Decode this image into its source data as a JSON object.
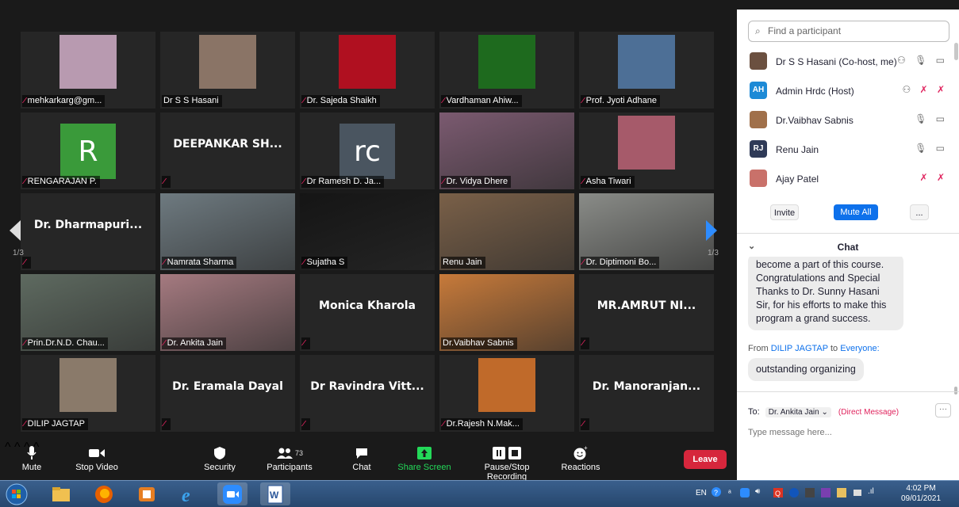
{
  "gallery": {
    "page_indicator_left": "1/3",
    "page_indicator_right": "1/3",
    "tiles": [
      {
        "name": "mehkarkarg@gm...",
        "muted": true,
        "kind": "photo",
        "photo_bg": "#b89ab0"
      },
      {
        "name": "Dr S S Hasani",
        "muted": false,
        "kind": "photo",
        "photo_bg": "#8a7466"
      },
      {
        "name": "Dr. Sajeda Shaikh",
        "muted": true,
        "kind": "photo",
        "photo_bg": "#b01020"
      },
      {
        "name": "Vardhaman Ahiw...",
        "muted": true,
        "kind": "photo",
        "photo_bg": "#1e6a1e"
      },
      {
        "name": "Prof. Jyoti Adhane",
        "muted": true,
        "kind": "photo",
        "photo_bg": "#4d6f96"
      },
      {
        "name": "RENGARAJAN P.",
        "muted": true,
        "kind": "letter",
        "letter": "R",
        "letter_bg": "#3a9a3a"
      },
      {
        "name": "",
        "muted": true,
        "kind": "text",
        "big": "DEEPANKAR SH..."
      },
      {
        "name": "Dr Ramesh D. Ja...",
        "muted": true,
        "kind": "letter",
        "letter": "rc",
        "letter_bg": "#4a5560"
      },
      {
        "name": "Dr. Vidya Dhere",
        "muted": true,
        "kind": "video",
        "photo_bg": "#7b5a70"
      },
      {
        "name": "Asha Tiwari",
        "muted": true,
        "kind": "photo",
        "photo_bg": "#a65a6a"
      },
      {
        "name": "",
        "muted": true,
        "kind": "text",
        "big": "Dr. Dharmapuri..."
      },
      {
        "name": "Namrata Sharma",
        "muted": true,
        "kind": "video",
        "photo_bg": "#6e7a80"
      },
      {
        "name": "Sujatha S",
        "muted": true,
        "kind": "video",
        "photo_bg": "#151515"
      },
      {
        "name": "Renu Jain",
        "muted": false,
        "kind": "video",
        "photo_bg": "#7a6048"
      },
      {
        "name": "Dr. Diptimoni Bo...",
        "muted": true,
        "kind": "video",
        "photo_bg": "#8a8c88"
      },
      {
        "name": "Prin.Dr.N.D. Chau...",
        "muted": true,
        "kind": "video",
        "photo_bg": "#5e6a60"
      },
      {
        "name": "Dr. Ankita Jain",
        "muted": true,
        "kind": "video",
        "photo_bg": "#a57a80"
      },
      {
        "name": "",
        "muted": true,
        "kind": "text",
        "big": "Monica Kharola"
      },
      {
        "name": "Dr.Vaibhav Sabnis",
        "muted": false,
        "kind": "video",
        "photo_bg": "#c77a3a",
        "active": true
      },
      {
        "name": "",
        "muted": true,
        "kind": "text",
        "big": "MR.AMRUT NI..."
      },
      {
        "name": "DILIP JAGTAP",
        "muted": true,
        "kind": "photo",
        "photo_bg": "#8a7a6a"
      },
      {
        "name": "",
        "muted": true,
        "kind": "text",
        "big": "Dr. Eramala Dayal"
      },
      {
        "name": "",
        "muted": true,
        "kind": "text",
        "big": "Dr Ravindra Vitt..."
      },
      {
        "name": "Dr.Rajesh N.Mak...",
        "muted": true,
        "kind": "photo",
        "photo_bg": "#c06a2a"
      },
      {
        "name": "",
        "muted": true,
        "kind": "text",
        "big": "Dr.  Manoranjan..."
      }
    ]
  },
  "toolbar": {
    "mute": "Mute",
    "stop_video": "Stop Video",
    "security": "Security",
    "participants": "Participants",
    "participants_count": "73",
    "chat": "Chat",
    "share_screen": "Share Screen",
    "record": "Pause/Stop Recording",
    "reactions": "Reactions",
    "leave": "Leave"
  },
  "participants_panel": {
    "search_placeholder": "Find a participant",
    "items": [
      {
        "name": "Dr S S Hasani (Co-host, me)",
        "initials": "",
        "avatar_bg": "#6b5040",
        "status": "⚇ 🎙 ▭"
      },
      {
        "name": "Admin Hrdc (Host)",
        "initials": "AH",
        "avatar_bg": "#1d8ad6",
        "status": "⚇ ✗ ✗"
      },
      {
        "name": "Dr.Vaibhav Sabnis",
        "initials": "",
        "avatar_bg": "#a0704a",
        "status": "🎙 ▭"
      },
      {
        "name": "Renu Jain",
        "initials": "RJ",
        "avatar_bg": "#2f3a57",
        "status": "🎙 ▭"
      },
      {
        "name": "Ajay Patel",
        "initials": "",
        "avatar_bg": "#c9716a",
        "status": "✗ ✗"
      }
    ],
    "invite": "Invite",
    "mute_all": "Mute All",
    "more": "..."
  },
  "chat": {
    "title": "Chat",
    "message1": "become a part of this course. Congratulations and Special Thanks to Dr. Sunny Hasani Sir, for his efforts to make this program a grand success.",
    "from_prefix": "From",
    "from_sender": "DILIP JAGTAP",
    "from_to": "to",
    "from_recipient": "Everyone:",
    "message2": "outstanding organizing",
    "to_label": "To:",
    "to_value": "Dr. Ankita Jain ⌄",
    "direct": "(Direct Message)",
    "input_placeholder": "Type message here..."
  },
  "taskbar": {
    "lang": "EN",
    "time": "4:02 PM",
    "date": "09/01/2021"
  },
  "colors": {
    "accent_blue": "#0e71eb",
    "leave_red": "#d6263c",
    "share_green": "#23d959",
    "muted_red": "#e0245e",
    "active_speaker": "#e3e39a"
  }
}
